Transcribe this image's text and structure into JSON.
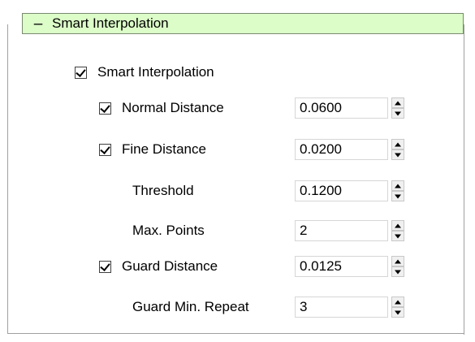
{
  "group": {
    "title": "Smart Interpolation",
    "collapse_symbol": "–"
  },
  "smart_interpolation": {
    "label": "Smart Interpolation",
    "checked": true
  },
  "fields": [
    {
      "label": "Normal Distance",
      "value": "0.0600",
      "checkbox": true,
      "checked": true
    },
    {
      "label": "Fine Distance",
      "value": "0.0200",
      "checkbox": true,
      "checked": true
    },
    {
      "label": "Threshold",
      "value": "0.1200",
      "checkbox": false
    },
    {
      "label": "Max. Points",
      "value": "2",
      "checkbox": false
    },
    {
      "label": "Guard Distance",
      "value": "0.0125",
      "checkbox": true,
      "checked": true
    },
    {
      "label": "Guard Min. Repeat",
      "value": "3",
      "checkbox": false
    }
  ],
  "colors": {
    "header_bg": "#dcfcc8",
    "border": "#a0a0a0"
  }
}
